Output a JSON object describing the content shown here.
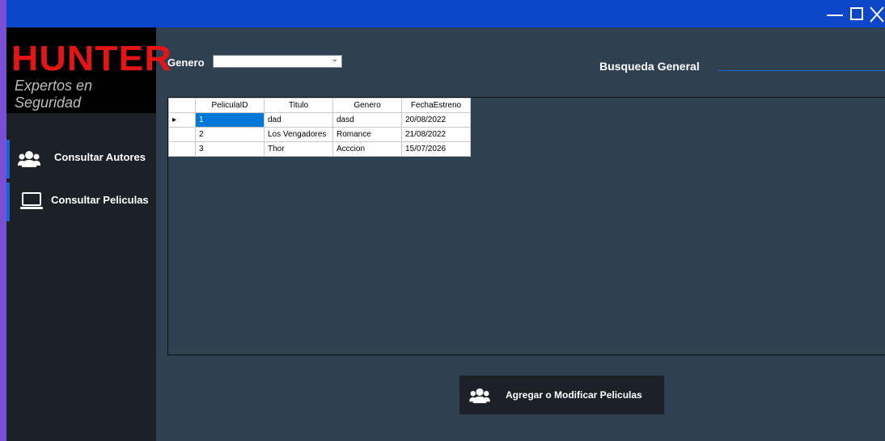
{
  "window": {
    "title": "",
    "controls": {
      "minimize": "minimize-icon",
      "maximize": "maximize-icon",
      "close": "close-icon"
    }
  },
  "logo": {
    "main": "HUNTER",
    "sub": "Expertos en Seguridad"
  },
  "sidebar": {
    "items": [
      {
        "label": "Consultar Autores",
        "icon": "users-icon"
      },
      {
        "label": "Consultar Peliculas",
        "icon": "laptop-icon"
      }
    ]
  },
  "filters": {
    "genero_label": "Genero",
    "genero_value": "",
    "busqueda_label": "Busqueda General",
    "busqueda_value": ""
  },
  "table": {
    "columns": [
      "PeliculaID",
      "Titulo",
      "Genero",
      "FechaEstreno"
    ],
    "rows": [
      [
        "1",
        "dad",
        "dasd",
        "20/08/2022"
      ],
      [
        "2",
        "Los Vengadores",
        "Romance",
        "21/08/2022"
      ],
      [
        "3",
        "Thor",
        "Acccion",
        "15/07/2026"
      ]
    ],
    "selected_row": 0
  },
  "actions": {
    "add_label": "Agregar o Modificar Peliculas",
    "add_icon": "users-icon"
  },
  "colors": {
    "titlebar": "#0d47c9",
    "sidebar": "#1b2127",
    "main_bg": "#2f4050",
    "logo_red": "#e51515",
    "accent": "#1565d8",
    "selection": "#0078d7"
  }
}
